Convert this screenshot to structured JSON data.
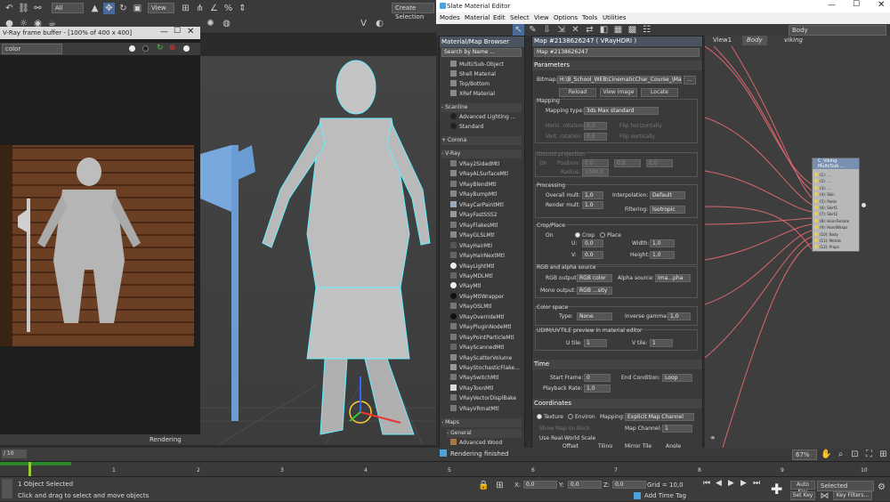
{
  "app": {
    "main_toolbar": {
      "selection_filter": "All",
      "view": "View",
      "create_selection": "Create Selection"
    },
    "vfb": {
      "title": "V-Ray frame buffer - [100% of 400 x 400]",
      "channel": "color",
      "status": "Rendering"
    },
    "sme": {
      "title": "Slate Material Editor",
      "menu": [
        "Modes",
        "Material",
        "Edit",
        "Select",
        "View",
        "Options",
        "Tools",
        "Utilities"
      ],
      "view_name": "Body",
      "browser": {
        "header": "Material/Map Browser",
        "search_placeholder": "Search by Name ...",
        "items_top": [
          "Multi/Sub-Object",
          "Shell Material",
          "Top/Bottom",
          "XRef Material"
        ],
        "group_scanline": "- Scanline",
        "items_scanline": [
          "Advanced Lighting ...",
          "Standard"
        ],
        "group_corona": "+ Corona",
        "group_vray": "- V-Ray",
        "items_vray": [
          "VRay2SidedMtl",
          "VRayALSurfaceMtl",
          "VRayBlendMtl",
          "VRayBumpMtl",
          "VRayCarPaintMtl",
          "VRayFastSSS2",
          "VRayFlakesMtl",
          "VRayGLSLMtl",
          "VRayHairMtl",
          "VRayHairNextMtl",
          "VRayLightMtl",
          "VRayMDLMtl",
          "VRayMtl",
          "VRayMtlWrapper",
          "VRayOSLMtl",
          "VRayOverrideMtl",
          "VRayPluginNodeMtl",
          "VRayPointParticleMtl",
          "VRayScannedMtl",
          "VRayScatterVolume",
          "VRayStochasticFlake...",
          "VRaySwitchMtl",
          "VRayToonMtl",
          "VRayVectorDisplBake",
          "VRayVRmatMtl"
        ],
        "group_maps": "- Maps",
        "group_general": "- General",
        "item_general": "Advanced Wood"
      },
      "params": {
        "header": "Map #2138626247  ( VRayHDRI )",
        "name_field": "Map #2138626247",
        "rollout_parameters": "Parameters",
        "bitmap_label": "Bitmap:",
        "bitmap_path": "H:\\B_School_WEB\\CinematicChar_Course_\\Maps",
        "bitmap_more": "...",
        "reload": "Reload",
        "view_image": "View image",
        "locate": "Locate",
        "mapping_title": "Mapping",
        "mapping_type_label": "Mapping type:",
        "mapping_type": "3ds Max standard",
        "horiz_rotation": "Horiz. rotation:",
        "vert_rotation": "Vert. rotation:",
        "rot_value": "0,0",
        "flip_h": "Flip horizontally",
        "flip_v": "Flip vertically",
        "ground_title": "Ground projection",
        "ground_on": "On",
        "position_label": "Position:",
        "pos_value": "0,0",
        "radius_label": "Radius:",
        "radius_value": "1000,0",
        "processing_title": "Processing",
        "overall_mult_label": "Overall mult:",
        "overall_mult": "1,0",
        "render_mult_label": "Render mult:",
        "render_mult": "1,0",
        "interpolation_label": "Interpolation:",
        "interpolation": "Default",
        "filtering_label": "Filtering:",
        "filtering": "Isotropic",
        "crop_title": "Crop/Place",
        "crop_on": "On",
        "crop": "Crop",
        "place": "Place",
        "u_label": "U:",
        "v_label": "V:",
        "width_label": "Width:",
        "height_label": "Height:",
        "zero": "0,0",
        "one": "1,0",
        "alpha_title": "RGB and alpha source",
        "rgb_output_label": "RGB output:",
        "rgb_output": "RGB color",
        "alpha_source_label": "Alpha source:",
        "alpha_source": "Ima...pha",
        "mono_output_label": "Mono output:",
        "mono_output": "RGB ...sity",
        "colorspace_title": "Color space",
        "type_label": "Type:",
        "type_value": "None",
        "inverse_gamma_label": "Inverse gamma:",
        "inverse_gamma": "1,0",
        "udim_title": "UDIM/UVTILE preview in material editor",
        "u_tile_label": "U tile:",
        "v_tile_label": "V tile:",
        "tile_value": "1",
        "rollout_time": "Time",
        "start_frame_label": "Start Frame:",
        "start_frame": "0",
        "end_condition_label": "End Condition:",
        "end_condition": "Loop",
        "playback_rate_label": "Playback Rate:",
        "playback_rate": "1,0",
        "rollout_coordinates": "Coordinates",
        "texture": "Texture",
        "environ": "Environ",
        "mapping_label": "Mapping:",
        "mapping_value": "Explicit Map Channel",
        "show_map": "Show Map on Back",
        "map_channel_label": "Map Channel:",
        "map_channel": "1",
        "use_real_world": "Use Real-World Scale",
        "offset": "Offset",
        "tiling": "Tiling",
        "mirror_tile": "Mirror Tile",
        "angle": "Angle"
      },
      "view_tabs": [
        "View1",
        "Body",
        "viking"
      ],
      "node": {
        "title": "C_Viking Multi/Sub ...",
        "slots": [
          "(1): ...",
          "(2): ...",
          "(3): ...",
          "(4): Skin",
          "(5): Pants",
          "(6): Skirt1",
          "(7): Skirt2",
          "(8): HairsFemale",
          "(9): HandWraps",
          "(10): Body",
          "(11): Metals",
          "(12): Props"
        ]
      },
      "status": "Rendering finished",
      "zoom": "67%"
    },
    "timeline": {
      "frame": "/ 10",
      "ticks": [
        "1",
        "2",
        "3",
        "4",
        "5",
        "6",
        "7",
        "8",
        "9",
        "10"
      ]
    },
    "statusbar": {
      "objects": "1 Object Selected",
      "prompt": "Click and drag to select and move objects",
      "x_label": "X:",
      "y_label": "Y:",
      "z_label": "Z:",
      "coord": "0,0",
      "grid": "Grid = 10,0",
      "add_time_tag": "Add Time Tag",
      "auto_key": "Auto Key",
      "set_key": "Set Key",
      "selected": "Selected",
      "key_filters": "Key Filters..."
    }
  }
}
